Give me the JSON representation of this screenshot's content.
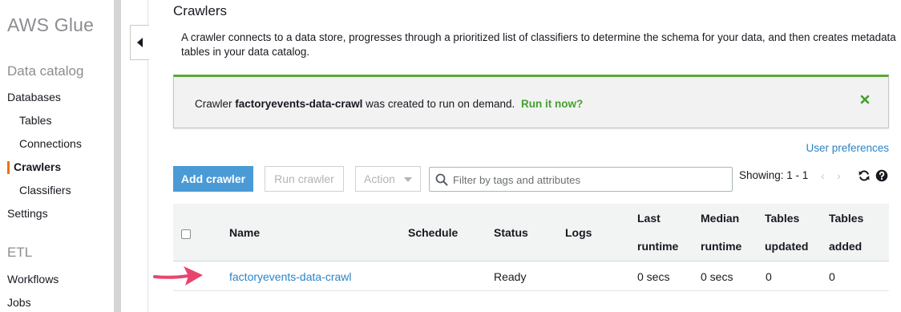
{
  "sidebar": {
    "brand": "AWS Glue",
    "section_data_catalog": "Data catalog",
    "section_etl": "ETL",
    "items": [
      {
        "label": "Databases"
      },
      {
        "label": "Tables"
      },
      {
        "label": "Connections"
      },
      {
        "label": "Crawlers",
        "active": true
      },
      {
        "label": "Classifiers"
      },
      {
        "label": "Settings"
      },
      {
        "label": "Workflows"
      },
      {
        "label": "Jobs"
      }
    ],
    "active_color": "#ec7211"
  },
  "page": {
    "title": "Crawlers",
    "description": "A crawler connects to a data store, progresses through a prioritized list of classifiers to determine the schema for your data, and then creates metadata tables in your data catalog."
  },
  "flash": {
    "prefix": "Crawler",
    "crawler_name": "factoryevents-data-crawl",
    "suffix": "was created to run on demand.",
    "link": "Run it now?",
    "status_color": "#5ba73a"
  },
  "toolbar": {
    "user_preferences": "User preferences",
    "add_crawler": "Add crawler",
    "run_crawler": "Run crawler",
    "action": "Action",
    "search_placeholder": "Filter by tags and attributes",
    "showing": "Showing: 1 - 1",
    "prev": "‹",
    "next": "›",
    "primary_color": "#4a9ad6"
  },
  "table": {
    "headers": {
      "name": "Name",
      "schedule": "Schedule",
      "status": "Status",
      "logs": "Logs",
      "last_runtime_1": "Last",
      "last_runtime_2": "runtime",
      "median_runtime_1": "Median",
      "median_runtime_2": "runtime",
      "tables_updated_1": "Tables",
      "tables_updated_2": "updated",
      "tables_added_1": "Tables",
      "tables_added_2": "added"
    },
    "rows": [
      {
        "name": "factoryevents-data-crawl",
        "schedule": "",
        "status": "Ready",
        "logs": "",
        "last_runtime": "0 secs",
        "median_runtime": "0 secs",
        "tables_updated": "0",
        "tables_added": "0"
      }
    ]
  },
  "annotation": {
    "arrow_color": "#e8456e"
  }
}
